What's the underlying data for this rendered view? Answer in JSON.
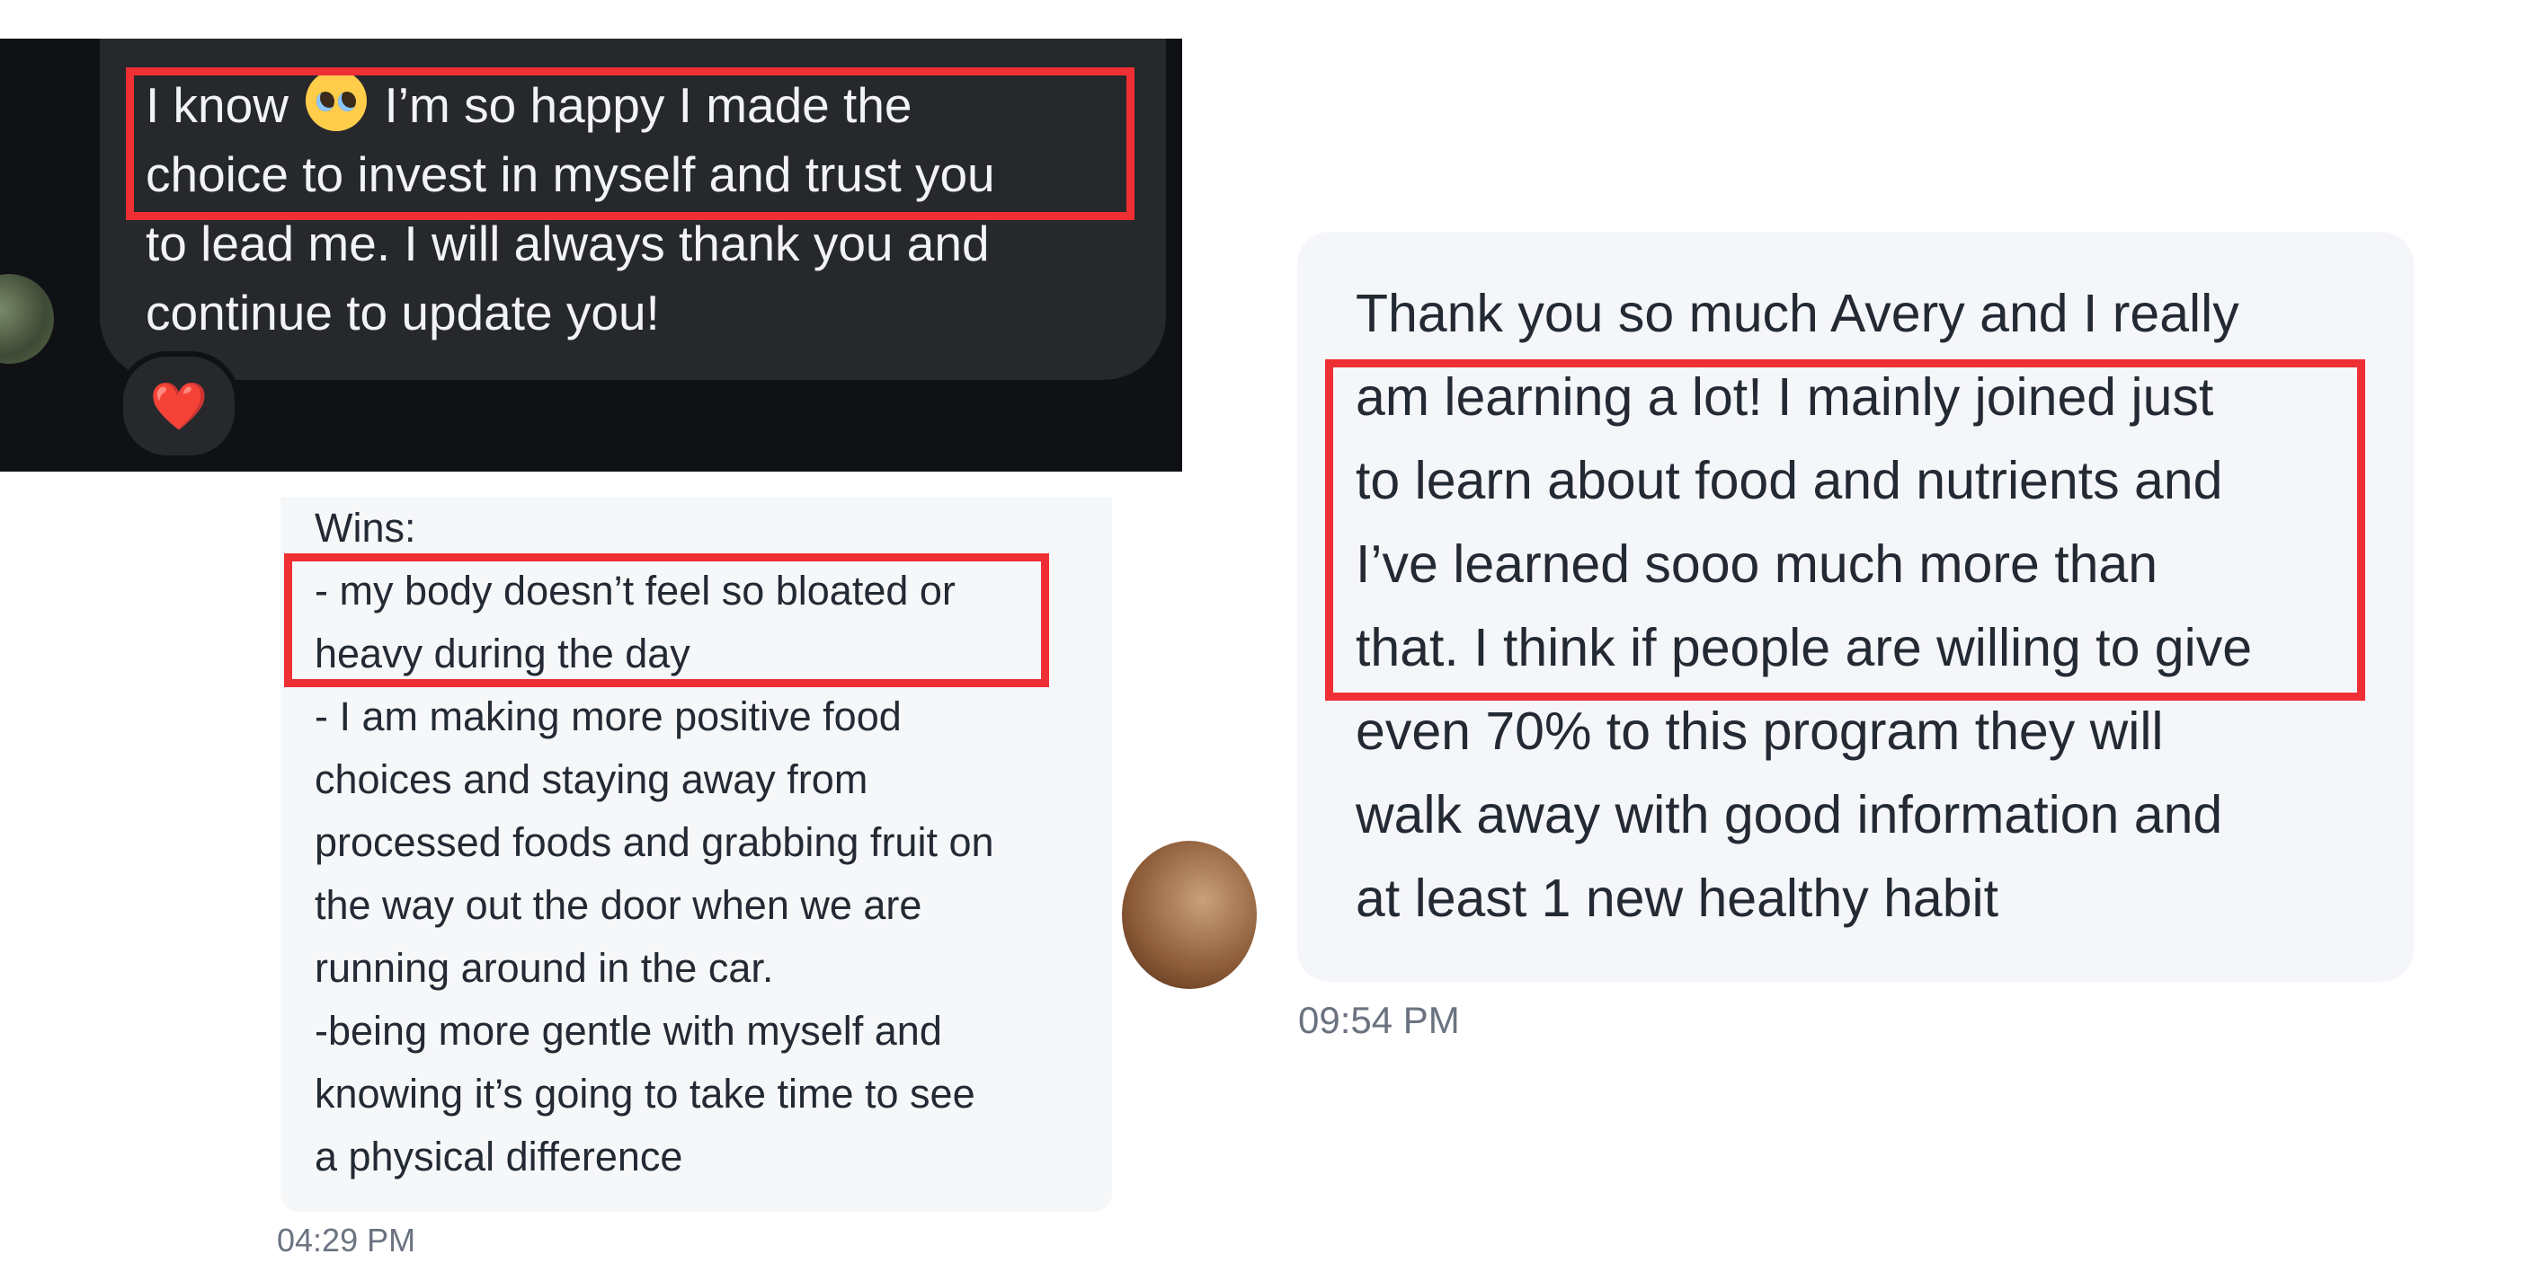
{
  "panel1": {
    "message_before_emoji": "I know ",
    "emoji": "pleading-face",
    "message_after_emoji": " I’m so happy I made the\nchoice to invest in myself and trust you\nto lead me. I will always thank you and\ncontinue to update you!",
    "reaction": "❤️"
  },
  "panel2": {
    "message": "Wins:\n- my body doesn’t feel so bloated or\nheavy during the day\n- I am making more positive food\nchoices and staying away from\nprocessed foods and grabbing fruit on\nthe way out the door when we are\nrunning around in the car.\n-being more gentle with myself and\nknowing it’s going to take time to see\na physical difference",
    "timestamp": "04:29 PM"
  },
  "panel3": {
    "message": "Thank you so much Avery and I really\nam learning a lot! I mainly joined just\nto learn about food and nutrients and\nI’ve learned sooo much more than\nthat. I think if people are willing to give\neven 70% to this program they will\nwalk away with good information and\nat least 1 new healthy habit",
    "timestamp": "09:54 PM"
  },
  "colors": {
    "highlight": "#ee2f34",
    "dark_bg": "#0f1114",
    "dark_bubble": "#26282c",
    "light_bubble": "#f5f6f9"
  }
}
